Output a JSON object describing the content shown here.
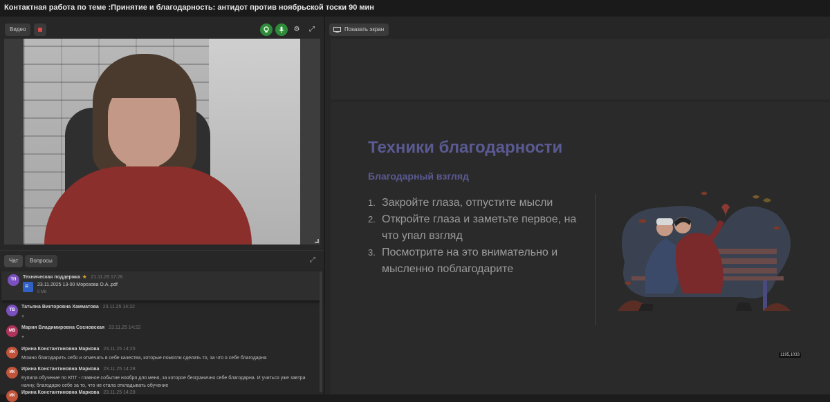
{
  "window": {
    "title": "Контактная работа по теме :Принятие и благодарность: антидот против ноябрьской тоски 90 мин"
  },
  "video_panel": {
    "label": "Видео",
    "icons": [
      "record-stop-icon",
      "camera-icon",
      "microphone-icon",
      "gear-icon",
      "expand-icon"
    ]
  },
  "screen_panel": {
    "label": "Показать экран"
  },
  "chat": {
    "tabs": [
      "Чат",
      "Вопросы"
    ],
    "messages": [
      {
        "initials": "ТП",
        "avatar_color": "#7a4fc0",
        "author": "Техническая поддержка",
        "starred": true,
        "time": "21.11.25 17:26",
        "file_name": "23.11.2025 13-00 Морозова О.А..pdf",
        "file_size": "0 Mb",
        "text": ""
      },
      {
        "initials": "ТВ",
        "avatar_color": "#7a4fc0",
        "author": "Татьяна Викторовна Хамматова",
        "time": "23.11.25 14:22",
        "text": "+"
      },
      {
        "initials": "МВ",
        "avatar_color": "#b0345a",
        "author": "Мария Владимировна Сосновская",
        "time": "23.11.25 14:22",
        "text": "+"
      },
      {
        "initials": "ИК",
        "avatar_color": "#c0533a",
        "author": "Ирина Константиновна Маркова",
        "time": "23.11.25 14:25",
        "text": "Можно благодарить себя и отмечать в себе качества, которые помогли сделать то, за что я себе благодарна"
      },
      {
        "initials": "ИК",
        "avatar_color": "#c0533a",
        "author": "Ирина Константиновна Маркова",
        "time": "23.11.25 14:28",
        "text": "Купила обучение по КПТ - главное событие ноября для меня, за которое безгранично себе благодарна. И учиться уже завтра начну, благодарю себе за то, что не стала откладывать обучение"
      },
      {
        "initials": "ИК",
        "avatar_color": "#c0533a",
        "author": "Ирина Константиновна Маркова",
        "time": "23.11.25 14:28",
        "text": ""
      }
    ]
  },
  "slide": {
    "title": "Техники благодарности",
    "subtitle": "Благодарный взгляд",
    "items": [
      {
        "num": "1.",
        "text": "Закройте глаза, отпустите мысли"
      },
      {
        "num": "2.",
        "text": "Откройте глаза и заметьте первое, на что упал взгляд"
      },
      {
        "num": "3.",
        "text": "Посмотрите на это внимательно и мысленно поблагодарите"
      }
    ],
    "title_color": "#5a5a92"
  },
  "cursor_readout": "1195,1033"
}
